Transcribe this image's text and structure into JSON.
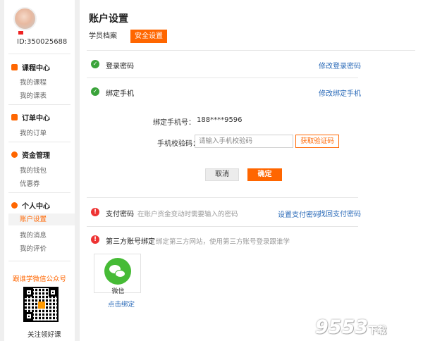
{
  "sidebar": {
    "user_id": "ID:350025688",
    "sections": [
      {
        "title": "课程中心",
        "items": [
          "我的课程",
          "我的课表"
        ]
      },
      {
        "title": "订单中心",
        "items": [
          "我的订单"
        ]
      },
      {
        "title": "资金管理",
        "items": [
          "我的钱包",
          "优惠券"
        ]
      },
      {
        "title": "个人中心",
        "items": [
          "账户设置",
          "我的消息",
          "我的评价"
        ]
      }
    ],
    "active_item": "账户设置",
    "wechat_title": "跟谁学微信公众号",
    "qr_caption": "关注领好课"
  },
  "main": {
    "title": "账户设置",
    "tabs": [
      {
        "label": "学员档案",
        "active": false
      },
      {
        "label": "安全设置",
        "active": true
      }
    ],
    "rows": {
      "login_password": {
        "label": "登录密码",
        "status": "ok",
        "action": "修改登录密码"
      },
      "bind_phone": {
        "label": "绑定手机",
        "status": "ok",
        "action": "修改绑定手机"
      },
      "pay_password": {
        "label": "支付密码",
        "status": "warn",
        "desc": "在账户资金变动时需要输入的密码",
        "action1": "设置支付密码",
        "action2": "找回支付密码"
      },
      "third_party": {
        "label": "第三方账号绑定",
        "status": "warn",
        "desc": "绑定第三方网站，使用第三方账号登录跟谁学"
      }
    },
    "phone_form": {
      "phone_label": "绑定手机号：",
      "phone_value": "188****9596",
      "code_label": "手机校验码：",
      "code_placeholder": "请输入手机校验码",
      "get_code_button": "获取验证码",
      "cancel_button": "取消",
      "confirm_button": "确定"
    },
    "wechat": {
      "label": "微信",
      "bind_link": "点击绑定"
    }
  },
  "watermark": {
    "text": "9553",
    "suffix": "下载"
  },
  "colors": {
    "accent": "#ff6600",
    "link": "#2a6ab8",
    "success": "#3aa33a",
    "warning": "#ee3333",
    "wechat": "#46bb36"
  }
}
